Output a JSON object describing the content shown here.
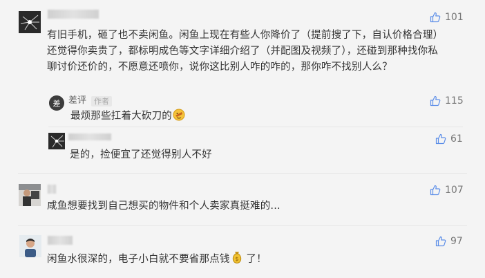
{
  "comments": [
    {
      "text": "有旧手机，砸了也不卖闲鱼。闲鱼上现在有些人你降价了（提前搜了下，自认价格合理）还觉得你卖贵了，都标明成色等文字详细介绍了（并配图及视频了），还碰到那种找你私聊讨价还价的，不愿意还喷你，说你这比别人咋的咋的，那你咋不找别人么？",
      "likes": "101",
      "replies": [
        {
          "author": "差评",
          "tag": "作者",
          "text": "最烦那些扛着大砍刀的",
          "likes": "115",
          "emoji": "emoji-icon"
        },
        {
          "text": "是的，捡便宜了还觉得别人不好",
          "likes": "61"
        }
      ]
    },
    {
      "text": "咸鱼想要找到自己想买的物件和个人卖家真挺难的...",
      "likes": "107"
    },
    {
      "text": "闲鱼水很深的，电子小白就不要省那点钱",
      "text_after": " 了！",
      "likes": "97",
      "emoji": "money-bag-icon"
    }
  ]
}
